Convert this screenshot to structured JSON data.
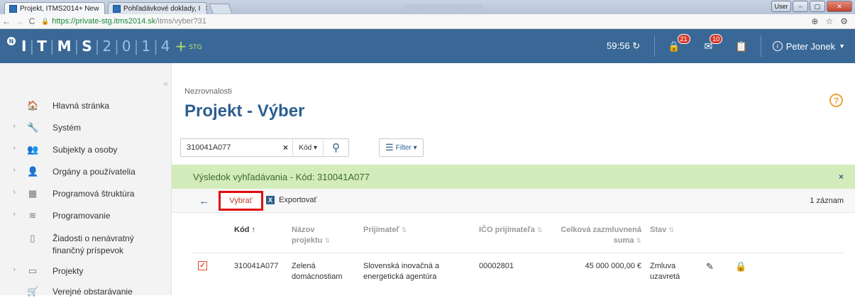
{
  "browser": {
    "tabs": [
      {
        "label": "Projekt, ITMS2014+ New",
        "active": true
      },
      {
        "label": "Pohľadávkové doklady, I",
        "active": false
      }
    ],
    "window_buttons": {
      "user": "User",
      "minimize": "–",
      "maximize": "▢",
      "close": "✕"
    },
    "url_host": "https://private-stg.itms2014.sk",
    "url_path": "/itms/vyber?31"
  },
  "header": {
    "badge": "N",
    "logo_letters": [
      "I",
      "T",
      "M",
      "S"
    ],
    "logo_digits": [
      "2",
      "0",
      "1",
      "4"
    ],
    "logo_plus": "+",
    "logo_env": "STG",
    "timer": "59:56",
    "notifications": {
      "lock_count": "21",
      "mail_count": "10"
    },
    "user_name": "Peter Jonek"
  },
  "sidebar": {
    "items": [
      {
        "label": "Hlavná stránka",
        "icon": "home-icon",
        "glyph": "🏠",
        "chevron": false
      },
      {
        "label": "Systém",
        "icon": "wrench-icon",
        "glyph": "🔧",
        "chevron": true
      },
      {
        "label": "Subjekty a osoby",
        "icon": "people-icon",
        "glyph": "👥",
        "chevron": true
      },
      {
        "label": "Orgány a používatelia",
        "icon": "users-icon",
        "glyph": "👤",
        "chevron": true
      },
      {
        "label": "Programová štruktúra",
        "icon": "structure-icon",
        "glyph": "▦",
        "chevron": true
      },
      {
        "label": "Programovanie",
        "icon": "layers-icon",
        "glyph": "≋",
        "chevron": true
      },
      {
        "label": "Žiadosti o nenávratný finančný príspevok",
        "icon": "document-icon",
        "glyph": "▯",
        "chevron": false
      },
      {
        "label": "Projekty",
        "icon": "folder-icon",
        "glyph": "▭",
        "chevron": true
      },
      {
        "label": "Verejné obstarávanie",
        "icon": "cart-icon",
        "glyph": "🛒",
        "chevron": false
      }
    ]
  },
  "main": {
    "breadcrumb": "Nezrovnalosti",
    "title": "Projekt - Výber",
    "help": "?",
    "search": {
      "value": "310041A077",
      "clear": "×",
      "field": "Kód ▾"
    },
    "filter_label": "Filter ▾",
    "result_text": "Výsledok vyhľadávania - Kód: 310041A077",
    "result_close": "×",
    "toolbar": {
      "back": "←",
      "select": "Vybrať",
      "export": "Exportovať",
      "count": "1 záznam"
    },
    "columns": [
      {
        "label": "Kód",
        "sort": "↑"
      },
      {
        "label": "Názov projektu",
        "sort": "⇅"
      },
      {
        "label": "Prijímateľ",
        "sort": "⇅"
      },
      {
        "label": "IČO prijímateľa",
        "sort": "⇅"
      },
      {
        "label": "Celková zazmluvnená suma",
        "sort": "⇅"
      },
      {
        "label": "Stav",
        "sort": "⇅"
      }
    ],
    "rows": [
      {
        "checked": true,
        "kod": "310041A077",
        "nazov": "Zelená domácnostiam",
        "prijimatel": "Slovenská inovačná a energetická agentúra",
        "ico": "00002801",
        "suma": "45 000 000,00 €",
        "stav": "Zmluva uzavretá"
      }
    ]
  }
}
